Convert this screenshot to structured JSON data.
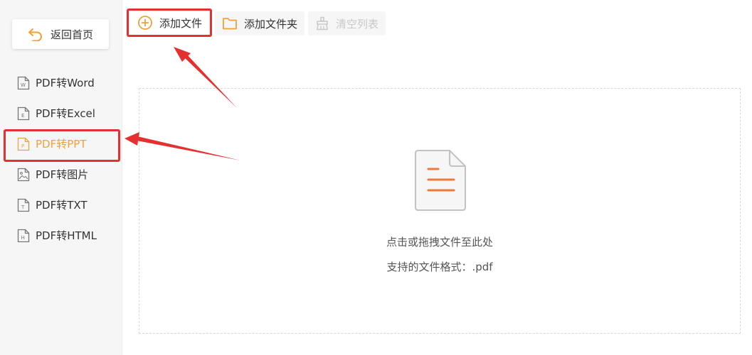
{
  "sidebar": {
    "back_label": "返回首页",
    "items": [
      {
        "label": "PDF转Word",
        "icon": "word-file-icon",
        "active": false
      },
      {
        "label": "PDF转Excel",
        "icon": "excel-file-icon",
        "active": false
      },
      {
        "label": "PDF转PPT",
        "icon": "ppt-file-icon",
        "active": true
      },
      {
        "label": "PDF转图片",
        "icon": "image-file-icon",
        "active": false
      },
      {
        "label": "PDF转TXT",
        "icon": "txt-file-icon",
        "active": false
      },
      {
        "label": "PDF转HTML",
        "icon": "html-file-icon",
        "active": false
      }
    ]
  },
  "toolbar": {
    "add_file_label": "添加文件",
    "add_folder_label": "添加文件夹",
    "clear_list_label": "清空列表"
  },
  "drop_zone": {
    "hint": "点击或拖拽文件至此处",
    "formats": "支持的文件格式：.pdf"
  },
  "colors": {
    "accent": "#f0a23a",
    "highlight_red": "#e53030",
    "sidebar_bg": "#f6f6f6"
  }
}
